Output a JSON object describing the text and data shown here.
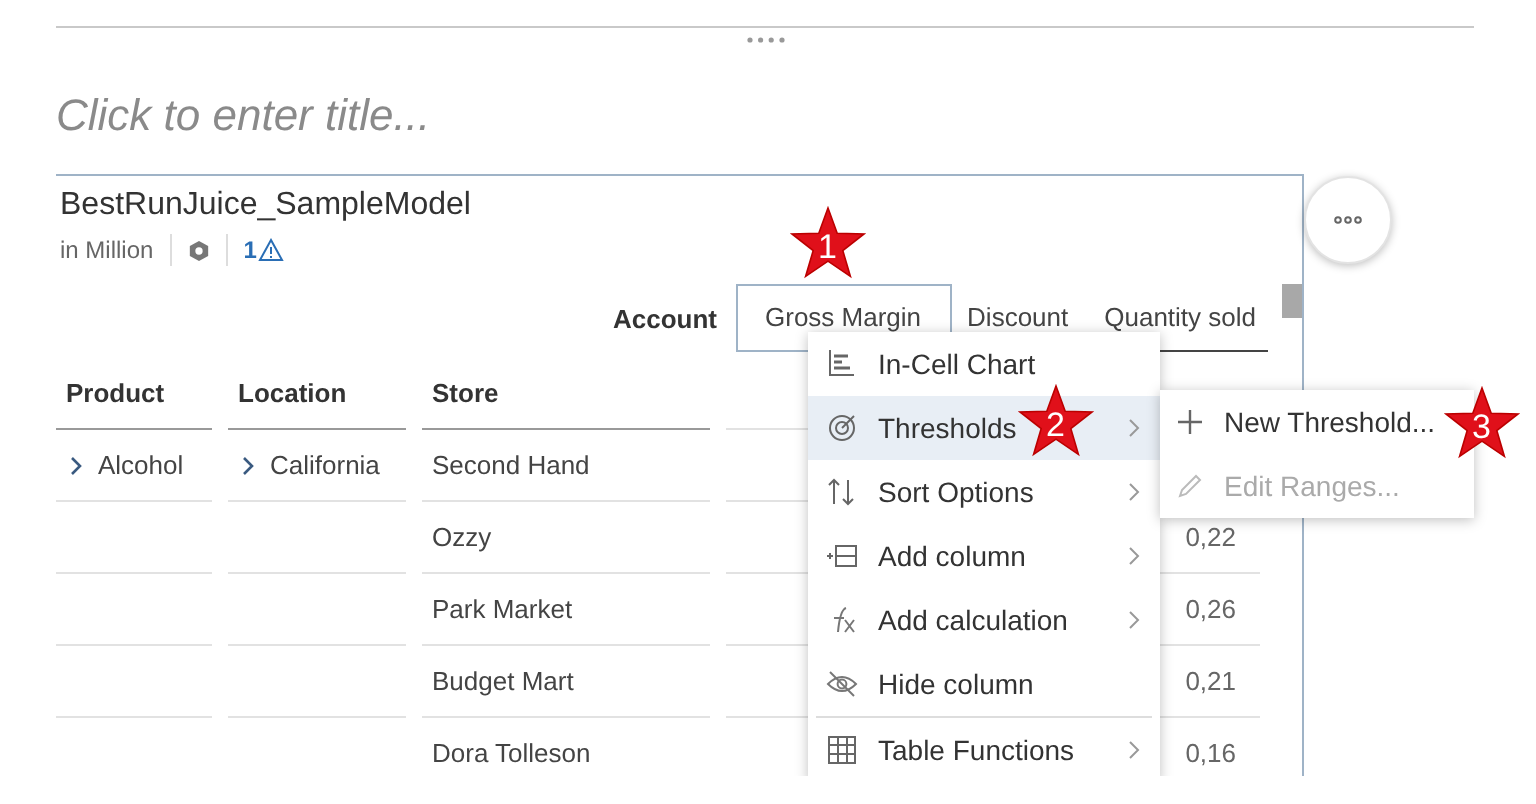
{
  "page_title": {
    "placeholder": "Click to enter title..."
  },
  "widget": {
    "title": "BestRunJuice_SampleModel",
    "unit": "in Million",
    "warning_count": "1",
    "dimension_header": "Account",
    "measures": [
      {
        "label": "Gross Margin",
        "selected": true
      },
      {
        "label": "Discount",
        "selected": false
      },
      {
        "label": "Quantity sold",
        "selected": false
      }
    ],
    "columns": [
      "Product",
      "Location",
      "Store"
    ],
    "rows": [
      {
        "product": "Alcohol",
        "product_expandable": true,
        "location": "California",
        "location_expandable": true,
        "store": "Second Hand"
      },
      {
        "store": "Ozzy",
        "value": "0,22"
      },
      {
        "store": "Park Market",
        "value": "0,26"
      },
      {
        "store": "Budget Mart",
        "value": "0,21"
      },
      {
        "store": "Dora Tolleson",
        "value": "0,16"
      }
    ]
  },
  "context_menu": [
    {
      "label": "In-Cell Chart",
      "selected": false,
      "has_submenu": false,
      "separator_before": false
    },
    {
      "label": "Thresholds",
      "selected": true,
      "has_submenu": true,
      "separator_before": false
    },
    {
      "label": "Sort Options",
      "selected": false,
      "has_submenu": true,
      "separator_before": false
    },
    {
      "label": "Add column",
      "selected": false,
      "has_submenu": true,
      "separator_before": false
    },
    {
      "label": "Add calculation",
      "selected": false,
      "has_submenu": true,
      "separator_before": false
    },
    {
      "label": "Hide column",
      "selected": false,
      "has_submenu": false,
      "separator_before": false
    },
    {
      "label": "Table Functions",
      "selected": false,
      "has_submenu": true,
      "separator_before": true
    }
  ],
  "submenu": [
    {
      "label": "New Threshold...",
      "disabled": false
    },
    {
      "label": "Edit Ranges...",
      "disabled": true
    }
  ],
  "callouts": [
    {
      "label": "1"
    },
    {
      "label": "2"
    },
    {
      "label": "3"
    }
  ]
}
